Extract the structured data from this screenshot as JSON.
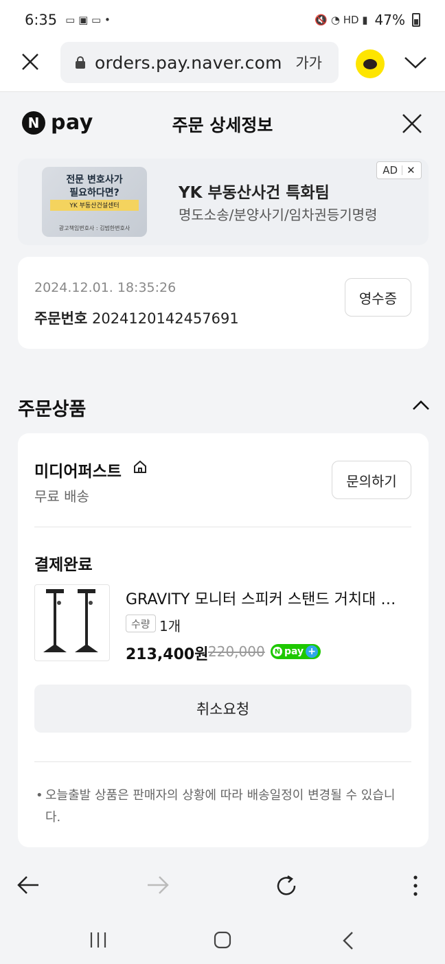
{
  "status_bar": {
    "time": "6:35",
    "battery": "47%"
  },
  "browser": {
    "url": "orders.pay.naver.com",
    "text_size_label": "가가"
  },
  "header": {
    "logo_n": "N",
    "logo_text": "pay",
    "title": "주문 상세정보"
  },
  "ad": {
    "image_line1": "전문 변호사가",
    "image_line2": "필요하다면?",
    "image_line3": "YK 부동산건설센터",
    "image_line4": "광고책임변호사 : 김범한변호사",
    "title": "YK 부동산사건 특화팀",
    "subtitle": "명도소송/분양사기/임차권등기명령",
    "badge": "AD",
    "badge_close": "✕"
  },
  "order": {
    "datetime": "2024.12.01. 18:35:26",
    "number_label": "주문번호",
    "number": "2024120142457691",
    "receipt_label": "영수증"
  },
  "products_section": {
    "title": "주문상품"
  },
  "seller": {
    "name": "미디어퍼스트",
    "shipping": "무료 배송",
    "inquiry_label": "문의하기",
    "status": "결제완료"
  },
  "product": {
    "name": "GRAVITY 모니터 스피커 스탠드 거치대 거치대 세트",
    "qty_label": "수량",
    "qty": "1개",
    "price": "213,400원",
    "original_price": "220,000",
    "badge_text": "pay",
    "cancel_label": "취소요청"
  },
  "notice": "오늘출발 상품은 판매자의 상황에 따라 배송일정이 변경될 수 있습니다."
}
